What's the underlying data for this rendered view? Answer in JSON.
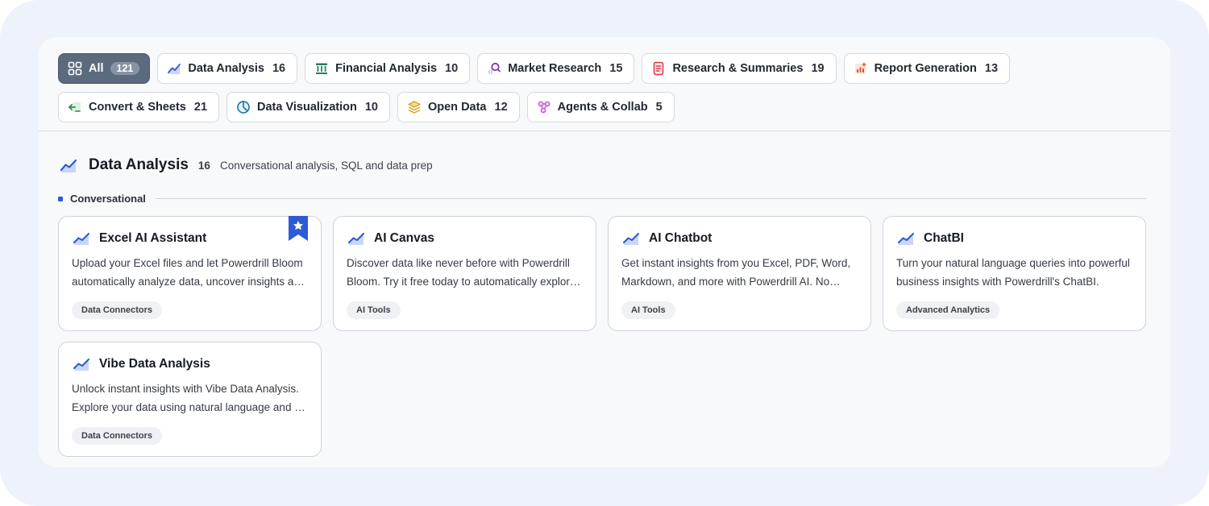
{
  "filters": {
    "row1": [
      {
        "label": "All",
        "count": "121",
        "icon": "grid-icon",
        "active": true
      },
      {
        "label": "Data Analysis",
        "count": "16",
        "icon": "trend-chart-icon"
      },
      {
        "label": "Financial Analysis",
        "count": "10",
        "icon": "bank-icon"
      },
      {
        "label": "Market Research",
        "count": "15",
        "icon": "magnifier-chart-icon"
      },
      {
        "label": "Research & Summaries",
        "count": "19",
        "icon": "document-icon"
      },
      {
        "label": "Report Generation",
        "count": "13",
        "icon": "report-chart-icon"
      }
    ],
    "row2": [
      {
        "label": "Convert & Sheets",
        "count": "21",
        "icon": "convert-icon"
      },
      {
        "label": "Data Visualization",
        "count": "10",
        "icon": "pie-icon"
      },
      {
        "label": "Open Data",
        "count": "12",
        "icon": "stack-icon"
      },
      {
        "label": "Agents & Collab",
        "count": "5",
        "icon": "network-icon"
      }
    ]
  },
  "section": {
    "title": "Data Analysis",
    "count": "16",
    "description": "Conversational analysis, SQL and data prep",
    "subsection": "Conversational"
  },
  "cards": [
    {
      "title": "Excel AI Assistant",
      "description": "Upload your Excel files and let Powerdrill Bloom automatically analyze data, uncover insights and generate reports.",
      "tag": "Data Connectors",
      "featured": true
    },
    {
      "title": "AI Canvas",
      "description": "Discover data like never before with Powerdrill Bloom. Try it free today to automatically explore your data.",
      "tag": "AI Tools"
    },
    {
      "title": "AI Chatbot",
      "description": "Get instant insights from you Excel, PDF, Word, Markdown, and more with Powerdrill AI. No coding required.",
      "tag": "AI Tools"
    },
    {
      "title": "ChatBI",
      "description": "Turn your natural language queries into powerful business insights with Powerdrill's ChatBI.",
      "tag": "Advanced Analytics"
    },
    {
      "title": "Vibe Data Analysis",
      "description": "Unlock instant insights with Vibe Data Analysis. Explore your data using natural language and get answers fast.",
      "tag": "Data Connectors"
    }
  ],
  "colors": {
    "accent": "#2d5bd8",
    "active_chip": "#5c6a7e",
    "panel": "#f8f9fb",
    "outer": "#eef3fb"
  }
}
